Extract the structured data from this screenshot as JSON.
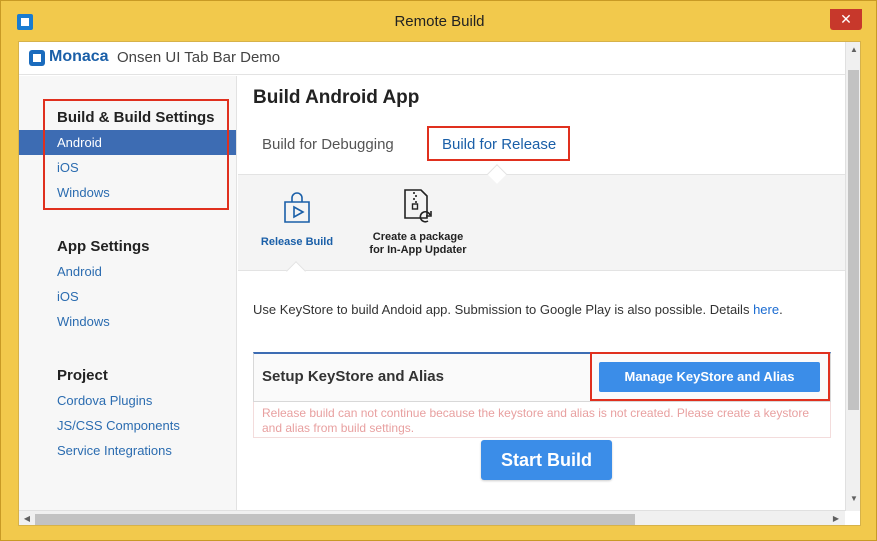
{
  "window": {
    "title": "Remote Build",
    "close_glyph": "✕"
  },
  "header": {
    "logo": "Monaca",
    "project": "Onsen UI Tab Bar Demo"
  },
  "sidebar": {
    "sections": [
      {
        "heading": "Build & Build Settings",
        "items": [
          "Android",
          "iOS",
          "Windows"
        ]
      },
      {
        "heading": "App Settings",
        "items": [
          "Android",
          "iOS",
          "Windows"
        ]
      },
      {
        "heading": "Project",
        "items": [
          "Cordova Plugins",
          "JS/CSS Components",
          "Service Integrations"
        ]
      }
    ],
    "active_item": "Android"
  },
  "main": {
    "title": "Build Android App",
    "tabs": [
      "Build for Debugging",
      "Build for Release"
    ],
    "selected_tab": "Build for Release",
    "sub_options": [
      {
        "label": "Release Build",
        "icon": "shopping-bag-play-icon"
      },
      {
        "label_line1": "Create a package",
        "label_line2": "for In-App Updater",
        "icon": "file-zip-refresh-icon"
      }
    ],
    "description": "Use KeyStore to build Andoid app. Submission to Google Play is also possible. Details",
    "description_link": "here",
    "description_end": ".",
    "setup_title": "Setup KeyStore and Alias",
    "manage_button": "Manage KeyStore and Alias",
    "error_message": "Release build can not continue because the keystore and alias is not created. Please create a keystore and alias from build settings.",
    "start_button": "Start Build"
  },
  "colors": {
    "frame": "#f2c94c",
    "accent": "#3d6cb3",
    "button": "#3b8de8",
    "highlight": "#e0301e"
  }
}
